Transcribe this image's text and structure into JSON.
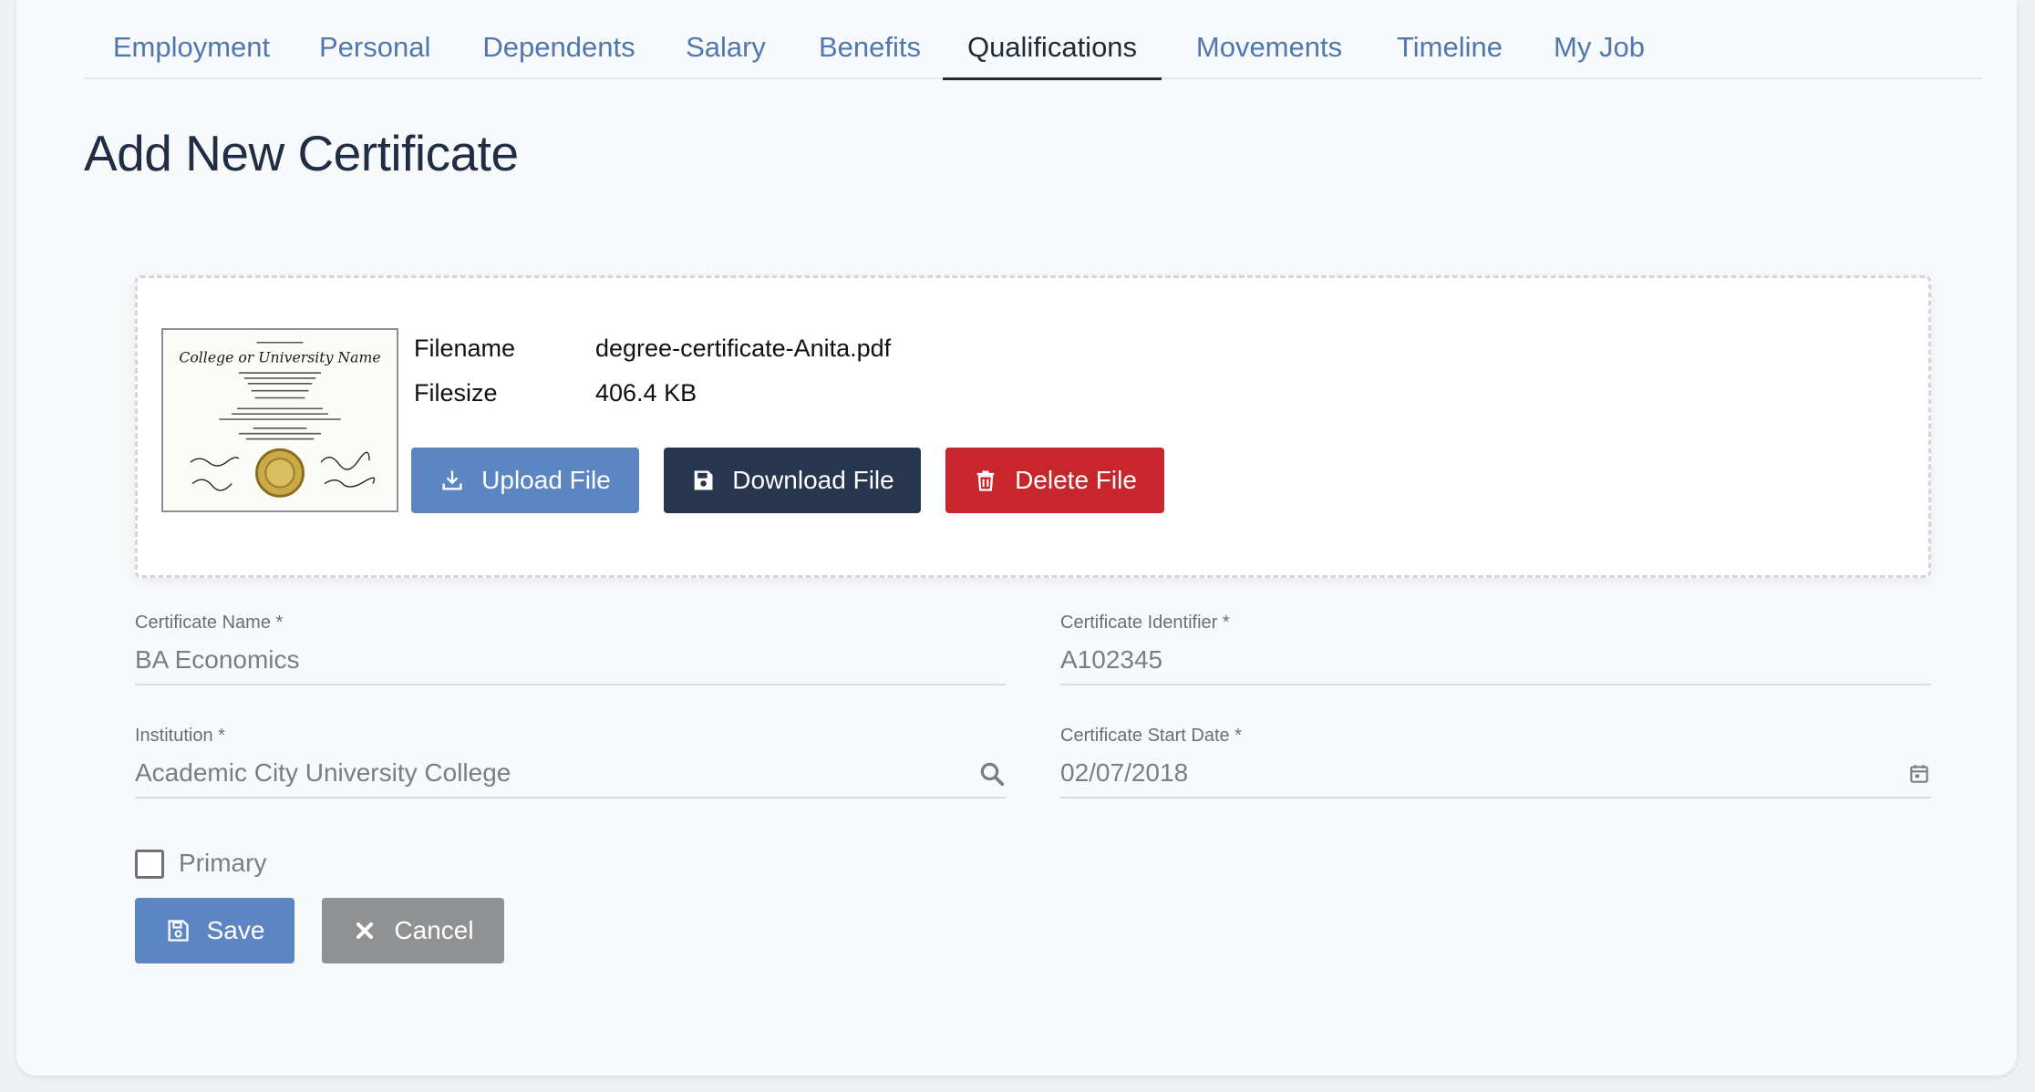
{
  "tabs": [
    {
      "label": "Employment",
      "active": false
    },
    {
      "label": "Personal",
      "active": false
    },
    {
      "label": "Dependents",
      "active": false
    },
    {
      "label": "Salary",
      "active": false
    },
    {
      "label": "Benefits",
      "active": false
    },
    {
      "label": "Qualifications",
      "active": true
    },
    {
      "label": "Movements",
      "active": false
    },
    {
      "label": "Timeline",
      "active": false
    },
    {
      "label": "My Job",
      "active": false
    }
  ],
  "page_title": "Add New Certificate",
  "file": {
    "filename_label": "Filename",
    "filename_value": "degree-certificate-Anita.pdf",
    "filesize_label": "Filesize",
    "filesize_value": "406.4 KB",
    "thumbnail_heading": "College or University Name",
    "upload_label": "Upload File",
    "download_label": "Download File",
    "delete_label": "Delete File"
  },
  "form": {
    "certificate_name": {
      "label": "Certificate Name *",
      "value": "BA Economics"
    },
    "certificate_identifier": {
      "label": "Certificate Identifier *",
      "value": "A102345"
    },
    "institution": {
      "label": "Institution *",
      "value": "Academic City University College",
      "icon": "search-icon"
    },
    "start_date": {
      "label": "Certificate Start Date *",
      "value": "02/07/2018",
      "icon": "calendar-icon"
    },
    "primary": {
      "label": "Primary",
      "checked": false
    }
  },
  "actions": {
    "save_label": "Save",
    "cancel_label": "Cancel"
  },
  "colors": {
    "primary": "#5b86c2",
    "dark": "#27364f",
    "danger": "#c8262d",
    "muted": "#8f9193",
    "tab_link": "#4f78b0"
  }
}
